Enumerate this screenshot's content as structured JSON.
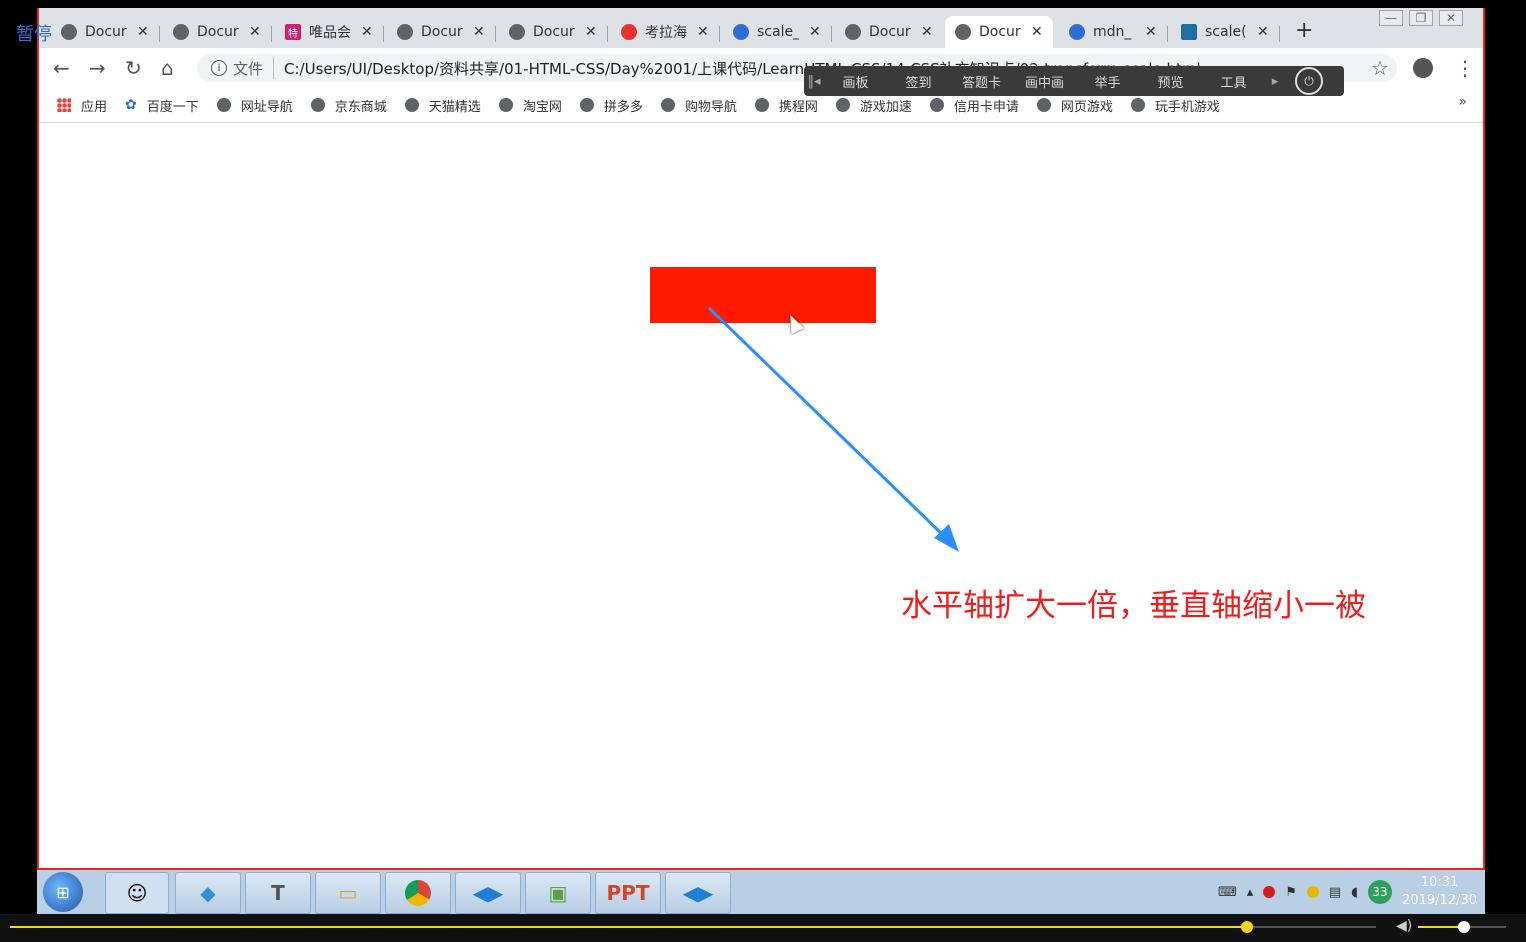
{
  "player": {
    "pause_label": "暂停"
  },
  "tabs": [
    {
      "title": "Docur",
      "icon": "globe-icon"
    },
    {
      "title": "Docur",
      "icon": "globe-icon"
    },
    {
      "title": "唯品会",
      "icon": "vip-icon"
    },
    {
      "title": "Docur",
      "icon": "globe-icon"
    },
    {
      "title": "Docur",
      "icon": "globe-icon"
    },
    {
      "title": "考拉海",
      "icon": "kaola-icon"
    },
    {
      "title": "scale_",
      "icon": "paw-icon"
    },
    {
      "title": "Docur",
      "icon": "globe-icon"
    },
    {
      "title": "Docur",
      "icon": "globe-icon",
      "active": true
    },
    {
      "title": "mdn_",
      "icon": "paw-icon"
    },
    {
      "title": "scale(",
      "icon": "mdn-icon"
    }
  ],
  "address": {
    "scheme_label": "文件",
    "url": "C:/Users/UI/Desktop/资料共享/01-HTML-CSS/Day%2001/上课代码/LearnHTML-CSS/14-CSS补充知识点/02-transform-scale.html"
  },
  "floating_toolbar": [
    "画板",
    "签到",
    "答题卡",
    "画中画",
    "举手",
    "预览",
    "工具"
  ],
  "bookmarks": [
    {
      "label": "应用",
      "icon": "apps-icon"
    },
    {
      "label": "百度一下",
      "icon": "paw-icon"
    },
    {
      "label": "网址导航",
      "icon": "globe-icon"
    },
    {
      "label": "京东商城",
      "icon": "globe-icon"
    },
    {
      "label": "天猫精选",
      "icon": "globe-icon"
    },
    {
      "label": "淘宝网",
      "icon": "globe-icon"
    },
    {
      "label": "拼多多",
      "icon": "globe-icon"
    },
    {
      "label": "购物导航",
      "icon": "globe-icon"
    },
    {
      "label": "携程网",
      "icon": "globe-icon"
    },
    {
      "label": "游戏加速",
      "icon": "globe-icon"
    },
    {
      "label": "信用卡申请",
      "icon": "globe-icon"
    },
    {
      "label": "网页游戏",
      "icon": "globe-icon"
    },
    {
      "label": "玩手机游戏",
      "icon": "globe-icon"
    }
  ],
  "page": {
    "box_color": "#ff1a00",
    "annotation": "水平轴扩大一倍，垂直轴缩小一被",
    "annotation_color": "#ef1d1d",
    "arrow_color": "#2a8fff"
  },
  "taskbar": {
    "apps": [
      "T",
      "PPT"
    ],
    "tray_badge": "33",
    "time": "10:31",
    "date": "2019/12/30"
  }
}
